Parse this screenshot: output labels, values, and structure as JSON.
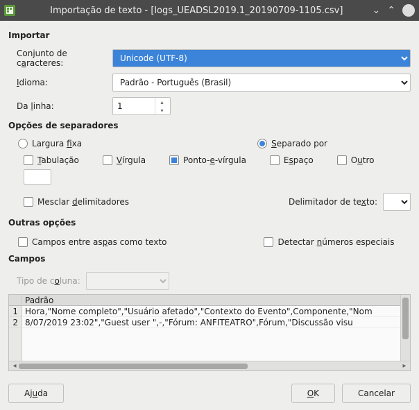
{
  "window": {
    "title": "Importação de texto - [logs_UEADSL2019.1_20190709-1105.csv]"
  },
  "sections": {
    "import": "Importar",
    "separators": "Opções de separadores",
    "other": "Outras opções",
    "fields": "Campos"
  },
  "import": {
    "charset_label": "Conjunto de caracteres:",
    "charset_value": "Unicode (UTF-8)",
    "language_label": "Idioma:",
    "language_value": "Padrão - Português (Brasil)",
    "from_line_label": "Da linha:",
    "from_line_value": "1"
  },
  "separator": {
    "fixed_width": "Largura fixa",
    "separated_by": "Separado por",
    "tab": "Tabulação",
    "comma": "Vírgula",
    "semicolon": "Ponto-e-vírgula",
    "space": "Espaço",
    "other": "Outro",
    "other_value": "",
    "merge": "Mesclar delimitadores",
    "text_delim_label": "Delimitador de texto:",
    "text_delim_value": ""
  },
  "other_opts": {
    "quoted_as_text": "Campos entre aspas como texto",
    "detect_numbers": "Detectar números especiais"
  },
  "fields": {
    "column_type_label": "Tipo de coluna:",
    "column_type_value": "",
    "header": "Padrão",
    "rows": [
      "Hora,\"Nome completo\",\"Usuário afetado\",\"Contexto do Evento\",Componente,\"Nom",
      "8/07/2019 23:02\",\"Guest user  \",-,\"Fórum: ANFITEATRO\",Fórum,\"Discussão visu"
    ],
    "line_numbers": [
      "1",
      "2"
    ]
  },
  "buttons": {
    "help": "Ajuda",
    "ok": "OK",
    "cancel": "Cancelar"
  }
}
